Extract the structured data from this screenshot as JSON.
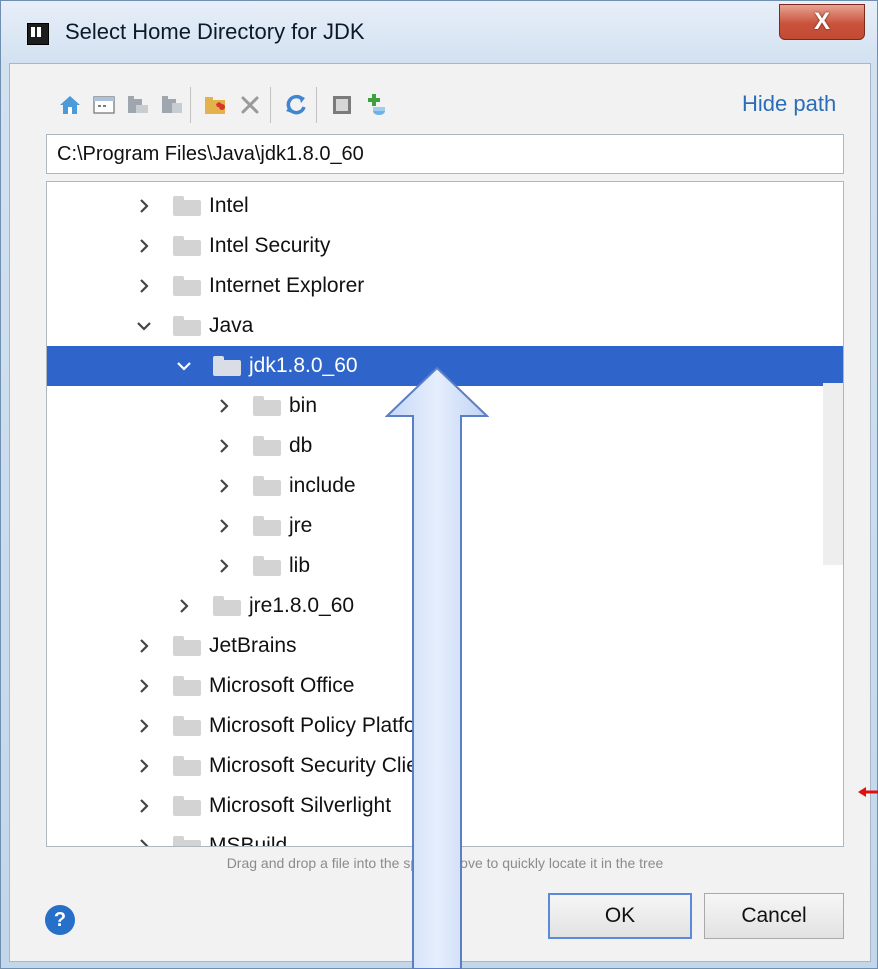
{
  "window": {
    "title": "Select Home Directory for JDK",
    "close_label": "X"
  },
  "toolbar": {
    "icons": [
      "home-icon",
      "desktop-icon",
      "project-icon",
      "module-icon",
      "new-folder-icon",
      "delete-icon",
      "refresh-icon",
      "show-hidden-icon",
      "add-sdk-icon"
    ],
    "hide_path_label": "Hide path"
  },
  "path": {
    "value": "C:\\Program Files\\Java\\jdk1.8.0_60"
  },
  "tree": {
    "rows": [
      {
        "label": "Intel",
        "level": 0,
        "expanded": false,
        "selected": false
      },
      {
        "label": "Intel Security",
        "level": 0,
        "expanded": false,
        "selected": false
      },
      {
        "label": "Internet Explorer",
        "level": 0,
        "expanded": false,
        "selected": false
      },
      {
        "label": "Java",
        "level": 0,
        "expanded": true,
        "selected": false
      },
      {
        "label": "jdk1.8.0_60",
        "level": 1,
        "expanded": true,
        "selected": true
      },
      {
        "label": "bin",
        "level": 2,
        "expanded": false,
        "selected": false
      },
      {
        "label": "db",
        "level": 2,
        "expanded": false,
        "selected": false
      },
      {
        "label": "include",
        "level": 2,
        "expanded": false,
        "selected": false
      },
      {
        "label": "jre",
        "level": 2,
        "expanded": false,
        "selected": false
      },
      {
        "label": "lib",
        "level": 2,
        "expanded": false,
        "selected": false
      },
      {
        "label": "jre1.8.0_60",
        "level": 1,
        "expanded": false,
        "selected": false
      },
      {
        "label": "JetBrains",
        "level": 0,
        "expanded": false,
        "selected": false
      },
      {
        "label": "Microsoft Office",
        "level": 0,
        "expanded": false,
        "selected": false
      },
      {
        "label": "Microsoft Policy Platform",
        "level": 0,
        "expanded": false,
        "selected": false
      },
      {
        "label": "Microsoft Security Client",
        "level": 0,
        "expanded": false,
        "selected": false
      },
      {
        "label": "Microsoft Silverlight",
        "level": 0,
        "expanded": false,
        "selected": false
      },
      {
        "label": "MSBuild",
        "level": 0,
        "expanded": false,
        "selected": false
      }
    ]
  },
  "hint": "Drag and drop a file into the space above to quickly locate it in the tree",
  "buttons": {
    "help": "?",
    "ok": "OK",
    "cancel": "Cancel"
  },
  "colors": {
    "selection": "#2f65ca",
    "link": "#2b6eb8",
    "help": "#2670c9"
  }
}
